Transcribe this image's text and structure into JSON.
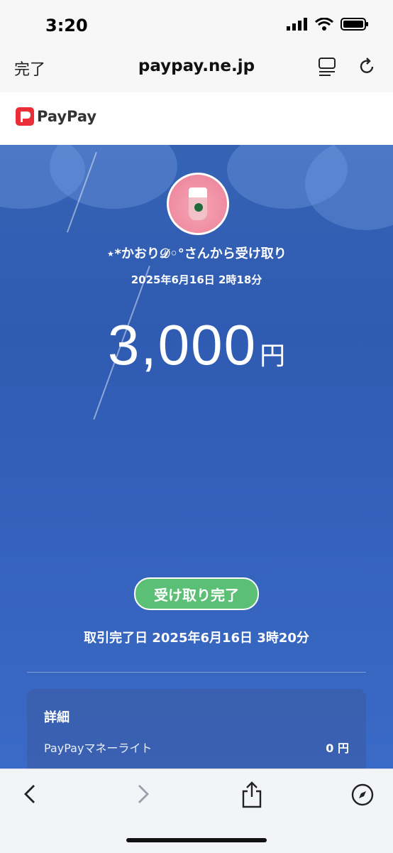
{
  "status_bar": {
    "time": "3:20"
  },
  "browser": {
    "done_label": "完了",
    "url": "paypay.ne.jp"
  },
  "brand": {
    "name": "PayPay",
    "accent": "#ea2d37"
  },
  "transaction": {
    "sender_line": "⋆*かおり𝒟◦°さんから受け取り",
    "datetime": "2025年6月16日 2時18分",
    "amount": "3,000",
    "currency": "円",
    "status_badge": "受け取り完了",
    "completed_line": "取引完了日 2025年6月16日 3時20分"
  },
  "details": {
    "title": "詳細",
    "rows": [
      {
        "label": "PayPayマネーライト",
        "value": "0 円"
      }
    ]
  },
  "colors": {
    "main_blue": "#2f5bb2",
    "badge_green": "#5cbf76"
  }
}
